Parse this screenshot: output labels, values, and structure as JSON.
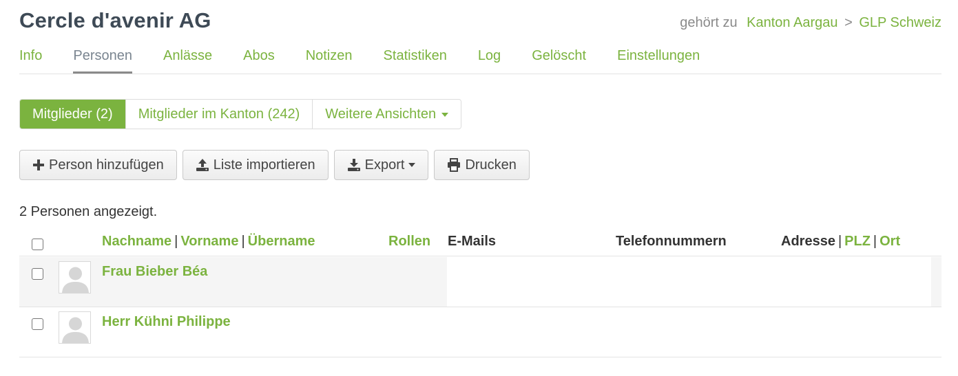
{
  "header": {
    "title": "Cercle d'avenir AG",
    "belongs_label": "gehört zu",
    "breadcrumb": [
      "Kanton Aargau",
      "GLP Schweiz"
    ],
    "breadcrumb_separator": ">"
  },
  "tabs": [
    {
      "label": "Info",
      "active": false
    },
    {
      "label": "Personen",
      "active": true
    },
    {
      "label": "Anlässe",
      "active": false
    },
    {
      "label": "Abos",
      "active": false
    },
    {
      "label": "Notizen",
      "active": false
    },
    {
      "label": "Statistiken",
      "active": false
    },
    {
      "label": "Log",
      "active": false
    },
    {
      "label": "Gelöscht",
      "active": false
    },
    {
      "label": "Einstellungen",
      "active": false
    }
  ],
  "views": [
    {
      "label": "Mitglieder (2)",
      "active": true
    },
    {
      "label": "Mitglieder im Kanton (242)",
      "active": false
    },
    {
      "label": "Weitere Ansichten",
      "active": false,
      "dropdown": true
    }
  ],
  "actions": [
    {
      "label": "Person hinzufügen",
      "icon": "plus-icon"
    },
    {
      "label": "Liste importieren",
      "icon": "upload-icon"
    },
    {
      "label": "Export",
      "icon": "download-icon",
      "dropdown": true
    },
    {
      "label": "Drucken",
      "icon": "print-icon"
    }
  ],
  "count_text": "2 Personen angezeigt.",
  "table": {
    "columns": {
      "nachname": "Nachname",
      "vorname": "Vorname",
      "uebername": "Übername",
      "rollen": "Rollen",
      "emails": "E-Mails",
      "telefon": "Telefonnummern",
      "adresse": "Adresse",
      "plz": "PLZ",
      "ort": "Ort",
      "separator": "|"
    },
    "rows": [
      {
        "name": "Frau Bieber Béa"
      },
      {
        "name": "Herr Kühni Philippe"
      }
    ]
  },
  "colors": {
    "accent": "#7bb33f",
    "title": "#3e4a56"
  }
}
